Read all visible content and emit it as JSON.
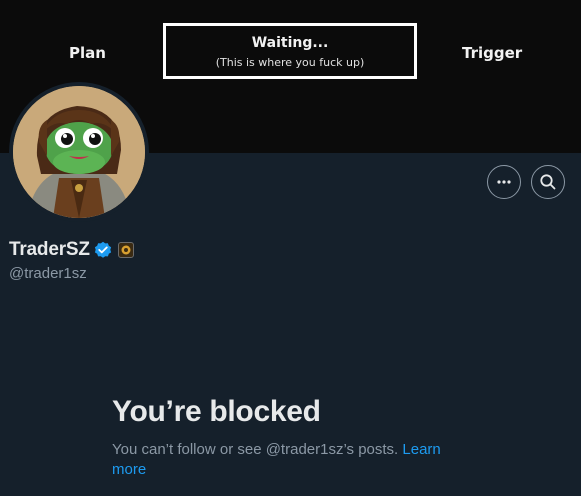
{
  "banner": {
    "left_label": "Plan",
    "box_title": "Waiting...",
    "box_subtitle": "(This is where you fuck up)",
    "right_label": "Trigger"
  },
  "profile": {
    "display_name": "TraderSZ",
    "handle": "@trader1sz",
    "verified_color": "#1d9bf0"
  },
  "actions": {
    "more_icon": "more-horizontal-icon",
    "search_icon": "search-icon"
  },
  "blocked": {
    "title": "You’re blocked",
    "message": "You can’t follow or see @trader1sz’s posts.",
    "link": "Learn more"
  },
  "colors": {
    "background": "#15202b",
    "banner": "#0b0b0b",
    "link": "#1d9bf0",
    "muted_text": "#8b98a5"
  }
}
